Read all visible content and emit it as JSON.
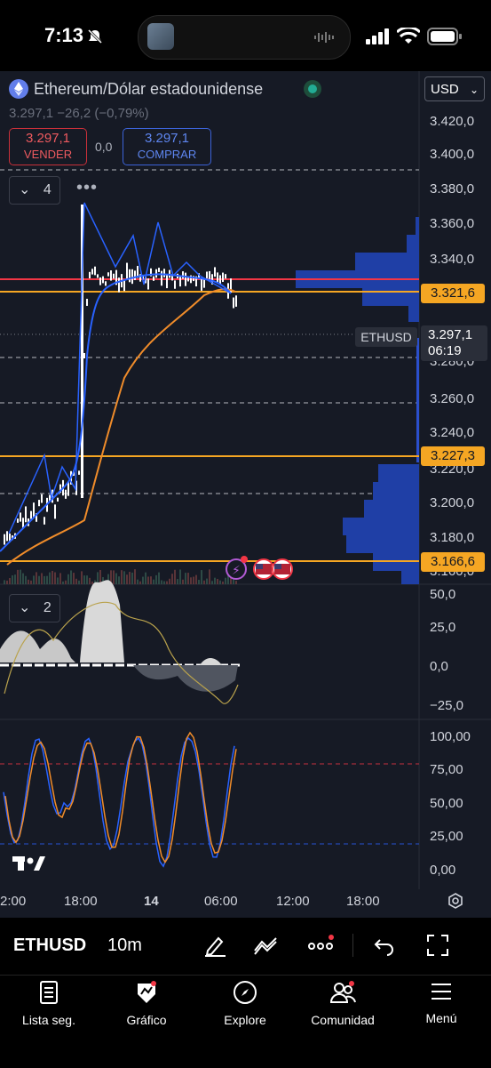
{
  "status": {
    "time": "7:13"
  },
  "header": {
    "title": "Ethereum/Dólar estadounidense",
    "price_line": "3.297,1  −26,2 (−0,79%)",
    "sell_price": "3.297,1",
    "sell_label": "VENDER",
    "spread": "0,0",
    "buy_price": "3.297,1",
    "buy_label": "COMPRAR",
    "currency": "USD",
    "indicators_count": "4"
  },
  "price_axis": {
    "labels": [
      "3.420,0",
      "3.400,0",
      "3.380,0",
      "3.360,0",
      "3.340,0",
      "3.280,0",
      "3.260,0",
      "3.240,0",
      "3.220,0",
      "3.200,0",
      "3.180,0",
      "3.160,0"
    ],
    "tag_red_top": "3.321,6",
    "current_symbol": "ETHUSD",
    "current_price": "3.297,1",
    "countdown": "06:19",
    "tag_orange_mid": "3.227,3",
    "tag_orange_low": "3.166,6"
  },
  "macd_pane": {
    "collapse_count": "2",
    "labels": [
      "50,0",
      "25,0",
      "0,0",
      "−25,0"
    ]
  },
  "stoch_pane": {
    "labels": [
      "100,00",
      "75,00",
      "50,00",
      "25,00",
      "0,00"
    ]
  },
  "time_axis": {
    "labels": [
      "2:00",
      "18:00",
      "14",
      "06:00",
      "12:00",
      "18:00"
    ]
  },
  "toolbar": {
    "symbol": "ETHUSD",
    "interval": "10m"
  },
  "bottom_nav": [
    {
      "label": "Lista seg.",
      "icon": "watchlist-icon"
    },
    {
      "label": "Gráfico",
      "icon": "chart-icon"
    },
    {
      "label": "Explore",
      "icon": "compass-icon"
    },
    {
      "label": "Comunidad",
      "icon": "community-icon"
    },
    {
      "label": "Menú",
      "icon": "menu-icon"
    }
  ],
  "colors": {
    "bg": "#161a25",
    "red": "#f23645",
    "orange": "#f5a623",
    "blue": "#2962ff",
    "white": "#ffffff"
  }
}
